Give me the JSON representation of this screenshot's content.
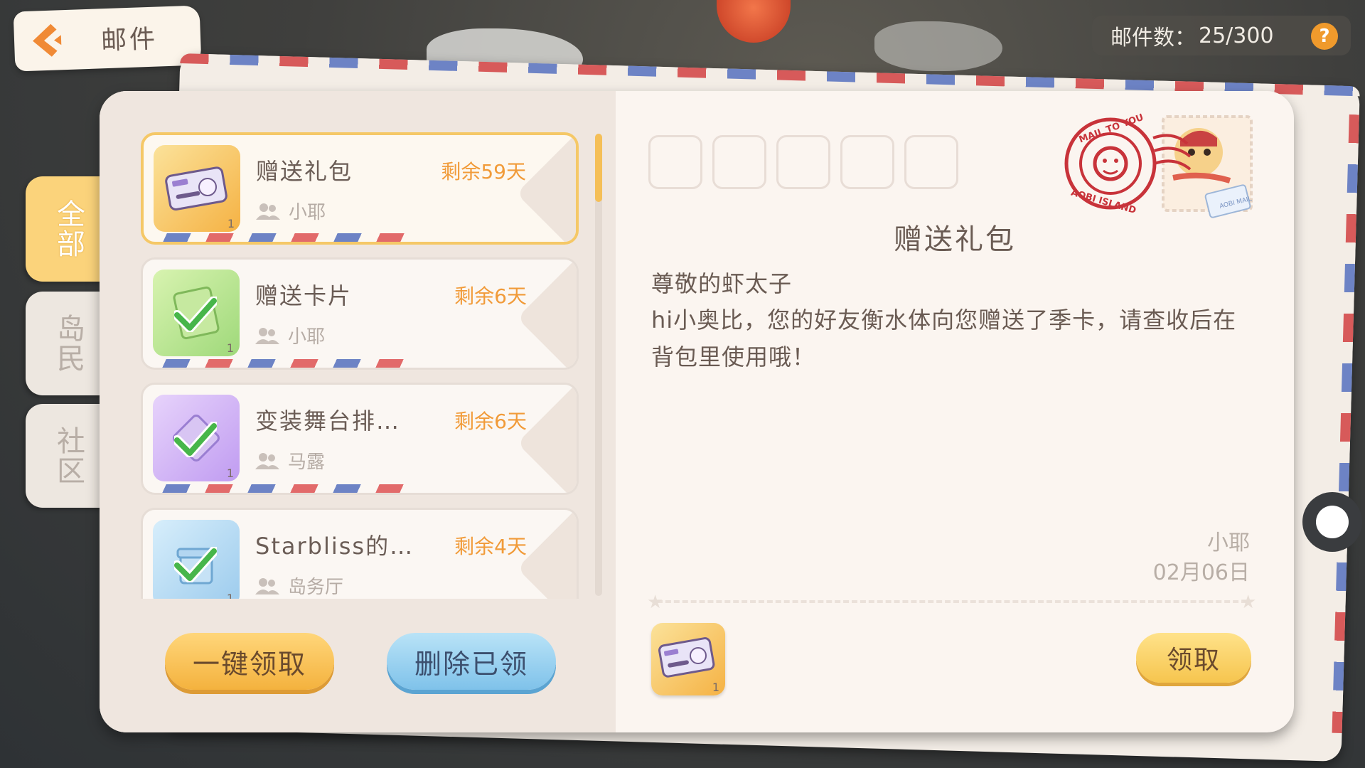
{
  "header": {
    "title": "邮件",
    "mail_count_label": "邮件数：",
    "mail_count_value": "25/300",
    "help_label": "?"
  },
  "tabs": [
    {
      "label": "全部",
      "active": true
    },
    {
      "label": "岛民",
      "active": false
    },
    {
      "label": "社区",
      "active": false
    }
  ],
  "mail_list": [
    {
      "title": "赠送礼包",
      "expiry": "剩余59天",
      "sender": "小耶",
      "count": "1",
      "claimed": false,
      "thumb": "season-card",
      "selected": true
    },
    {
      "title": "赠送卡片",
      "expiry": "剩余6天",
      "sender": "小耶",
      "count": "1",
      "claimed": true,
      "thumb": "card",
      "selected": false
    },
    {
      "title": "变装舞台排…",
      "expiry": "剩余6天",
      "sender": "马露",
      "count": "1",
      "claimed": true,
      "thumb": "ticket",
      "selected": false
    },
    {
      "title": "Starbliss的…",
      "expiry": "剩余4天",
      "sender": "岛务厅",
      "count": "1",
      "claimed": true,
      "thumb": "gift",
      "selected": false
    }
  ],
  "buttons": {
    "claim_all": "一键领取",
    "delete_claimed": "删除已领",
    "claim": "领取"
  },
  "detail": {
    "title": "赠送礼包",
    "greeting": "尊敬的虾太子",
    "body": "hi小奥比，您的好友衡水体向您赠送了季卡，请查收后在背包里使用哦！",
    "sender": "小耶",
    "date": "02月06日",
    "attachment_count": "1",
    "postmark_text_top": "MAIL TO YOU",
    "postmark_text_bottom": "AOBI ISLAND",
    "stamp_label": "AOBI MAIL"
  },
  "colors": {
    "accent_orange": "#f19b39",
    "tab_active": "#fbd37b",
    "card_bg": "#fbf5f0"
  }
}
